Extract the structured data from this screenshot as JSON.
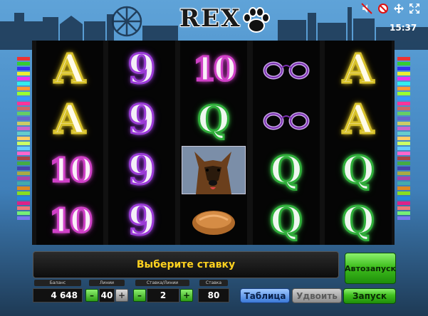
{
  "header": {
    "title": "REX",
    "clock": "15:37"
  },
  "icons": {
    "top_right": [
      "sound-off-icon",
      "settings-icon",
      "move-icon",
      "fullscreen-icon"
    ],
    "logo": "paw-icon"
  },
  "reels": [
    [
      "A",
      "A",
      "10",
      "10"
    ],
    [
      "9",
      "9",
      "9",
      "9"
    ],
    [
      "10",
      "Q",
      "dog",
      "bun"
    ],
    [
      "handcuffs",
      "handcuffs",
      "Q",
      "Q"
    ],
    [
      "A",
      "A",
      "Q",
      "Q"
    ]
  ],
  "message": "Выберите ставку",
  "controls": {
    "balance_label": "Баланс",
    "balance_value": "4 648",
    "lines_label": "Линии",
    "lines_value": "40",
    "bet_label": "Ставка/Линии",
    "bet_value": "2",
    "total_label": "Ставка",
    "total_value": "80",
    "minus": "–",
    "plus": "+",
    "table_button": "Таблица",
    "double_button": "Удвоить",
    "auto_button": "Автозапуск",
    "spin_button": "Запуск"
  },
  "colors": {
    "accent_green": "#3fbf1e",
    "message_text": "#ffd21f",
    "table_blue": "#3b7ad8"
  }
}
